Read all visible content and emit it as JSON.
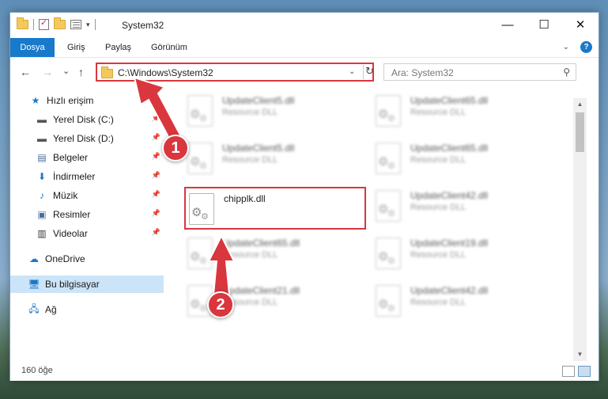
{
  "window": {
    "title": "System32",
    "controls": {
      "minimize": "—",
      "maximize": "☐",
      "close": "✕"
    }
  },
  "ribbon": {
    "tabs": [
      "Dosya",
      "Giriş",
      "Paylaş",
      "Görünüm"
    ],
    "help": "?"
  },
  "nav": {
    "back": "←",
    "forward": "→",
    "recent": "⌄",
    "up": "↑",
    "address": "C:\\Windows\\System32",
    "search_placeholder": "Ara: System32"
  },
  "sidebar": {
    "items": [
      {
        "label": "Hızlı erişim",
        "icon": "star-icon",
        "pinned": false
      },
      {
        "label": "Yerel Disk (C:)",
        "icon": "drive-icon",
        "pinned": true
      },
      {
        "label": "Yerel Disk (D:)",
        "icon": "drive-icon",
        "pinned": true
      },
      {
        "label": "Belgeler",
        "icon": "documents-icon",
        "pinned": true
      },
      {
        "label": "İndirmeler",
        "icon": "download-icon",
        "pinned": true
      },
      {
        "label": "Müzik",
        "icon": "music-icon",
        "pinned": true
      },
      {
        "label": "Resimler",
        "icon": "pictures-icon",
        "pinned": true
      },
      {
        "label": "Videolar",
        "icon": "video-icon",
        "pinned": true
      },
      {
        "label": "OneDrive",
        "icon": "cloud-icon",
        "pinned": false
      },
      {
        "label": "Bu bilgisayar",
        "icon": "computer-icon",
        "pinned": false,
        "selected": true
      },
      {
        "label": "Ağ",
        "icon": "network-icon",
        "pinned": false
      }
    ]
  },
  "files": {
    "selected": {
      "name": "chipplk.dll",
      "type": ""
    },
    "left_column": [
      {
        "name": "UpdateClient5.dll",
        "type": "Resource DLL"
      },
      {
        "name": "UpdateClient5.dll",
        "type": "Resource DLL"
      },
      {
        "name": "UpdateClient65.dll",
        "type": "Resource DLL"
      },
      {
        "name": "UpdateClient21.dll",
        "type": "Resource DLL"
      }
    ],
    "right_column": [
      {
        "name": "UpdateClient65.dll",
        "type": "Resource DLL"
      },
      {
        "name": "UpdateClient65.dll",
        "type": "Resource DLL"
      },
      {
        "name": "UpdateClient42.dll",
        "type": "Resource DLL"
      },
      {
        "name": "UpdateClient19.dll",
        "type": "Resource DLL"
      },
      {
        "name": "UpdateClient42.dll",
        "type": "Resource DLL"
      }
    ]
  },
  "status": {
    "item_count": "160 öğe"
  },
  "annotations": [
    {
      "label": "1"
    },
    {
      "label": "2"
    }
  ],
  "colors": {
    "accent": "#1979ca",
    "highlight": "#d9363e",
    "selection": "#cce4f7"
  }
}
